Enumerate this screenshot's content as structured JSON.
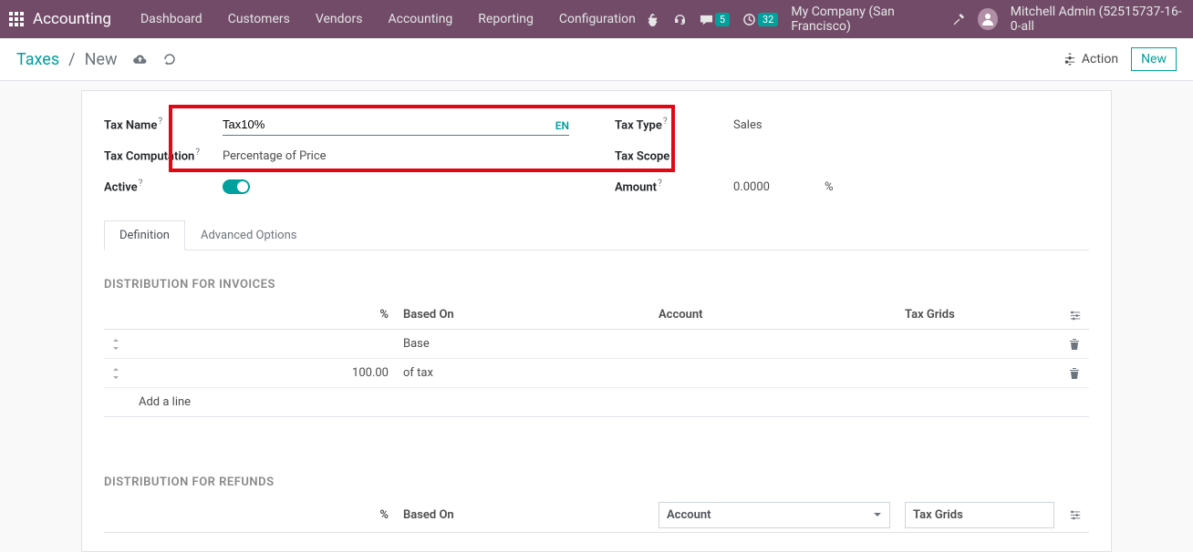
{
  "topbar": {
    "brand": "Accounting",
    "menu": [
      "Dashboard",
      "Customers",
      "Vendors",
      "Accounting",
      "Reporting",
      "Configuration"
    ],
    "messages_badge": "5",
    "activities_badge": "32",
    "company": "My Company (San Francisco)",
    "user": "Mitchell Admin (52515737-16-0-all"
  },
  "breadcrumb": {
    "root": "Taxes",
    "current": "New"
  },
  "actions": {
    "action_label": "Action",
    "new_label": "New"
  },
  "form": {
    "tax_name_label": "Tax Name",
    "tax_name_value": "Tax10%",
    "lang": "EN",
    "tax_computation_label": "Tax Computation",
    "tax_computation_value": "Percentage of Price",
    "active_label": "Active",
    "tax_type_label": "Tax Type",
    "tax_type_value": "Sales",
    "tax_scope_label": "Tax Scope",
    "amount_label": "Amount",
    "amount_value": "0.0000",
    "amount_unit": "%"
  },
  "tabs": {
    "definition": "Definition",
    "advanced": "Advanced Options"
  },
  "sections": {
    "invoices_title": "DISTRIBUTION FOR INVOICES",
    "refunds_title": "DISTRIBUTION FOR REFUNDS",
    "cols": {
      "pct": "%",
      "based_on": "Based On",
      "account": "Account",
      "tax_grids": "Tax Grids"
    },
    "rows": [
      {
        "pct": "",
        "based_on": "Base"
      },
      {
        "pct": "100.00",
        "based_on": "of tax"
      }
    ],
    "add_line": "Add a line"
  }
}
